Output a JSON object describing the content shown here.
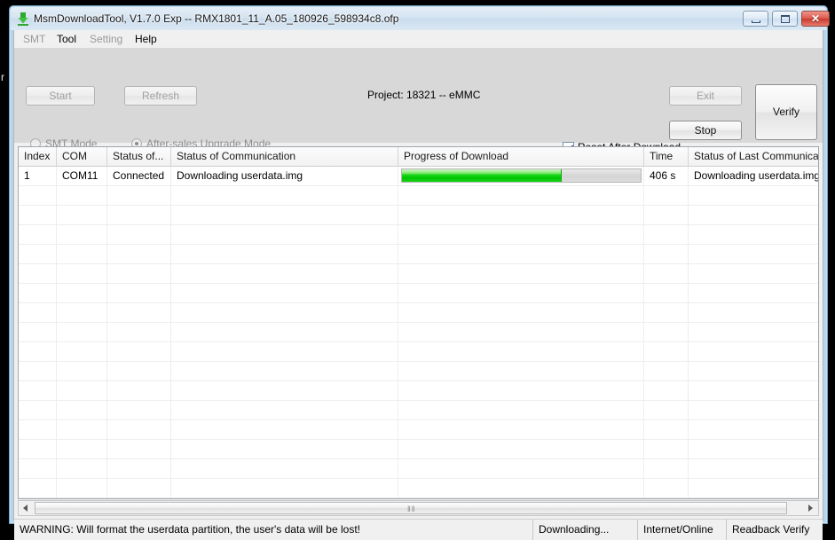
{
  "desktop": {
    "artifact_text": "r"
  },
  "window": {
    "icon": "download-arrow-icon",
    "title": "MsmDownloadTool, V1.7.0 Exp -- RMX1801_11_A.05_180926_598934c8.ofp",
    "controls": {
      "minimize": "minimize-icon",
      "maximize": "maximize-icon",
      "close_glyph": "✕"
    }
  },
  "menu": {
    "items": [
      {
        "label": "SMT",
        "enabled": false
      },
      {
        "label": "Tool",
        "enabled": true
      },
      {
        "label": "Setting",
        "enabled": false
      },
      {
        "label": "Help",
        "enabled": true
      }
    ]
  },
  "toolbar": {
    "start_label": "Start",
    "refresh_label": "Refresh",
    "exit_label": "Exit",
    "stop_label": "Stop",
    "verify_label": "Verify",
    "project_label": "Project: 18321 -- eMMC",
    "mode_smt_label": "SMT Mode",
    "mode_aftersales_label": "After-sales Upgrade Mode",
    "reset_after_download_label": "Reset After Download"
  },
  "grid": {
    "columns": [
      "Index",
      "COM",
      "Status of...",
      "Status of Communication",
      "Progress of Download",
      "Time",
      "Status of Last Communication"
    ],
    "rows": [
      {
        "index": "1",
        "com": "COM11",
        "status": "Connected",
        "communication": "Downloading userdata.img",
        "progress_percent": 67,
        "time": "406 s",
        "last_communication": "Downloading userdata.img"
      }
    ],
    "empty_row_count": 17,
    "progress_color": "#00c400"
  },
  "scrollbar": {
    "left_arrow": "arrow-left-icon",
    "right_arrow": "arrow-right-icon",
    "grip": "‖‖"
  },
  "status_bar": {
    "warning": "WARNING: Will format the userdata partition, the user's data will be lost!",
    "state": "Downloading...",
    "network": "Internet/Online",
    "verify_mode": "Readback Verify"
  }
}
